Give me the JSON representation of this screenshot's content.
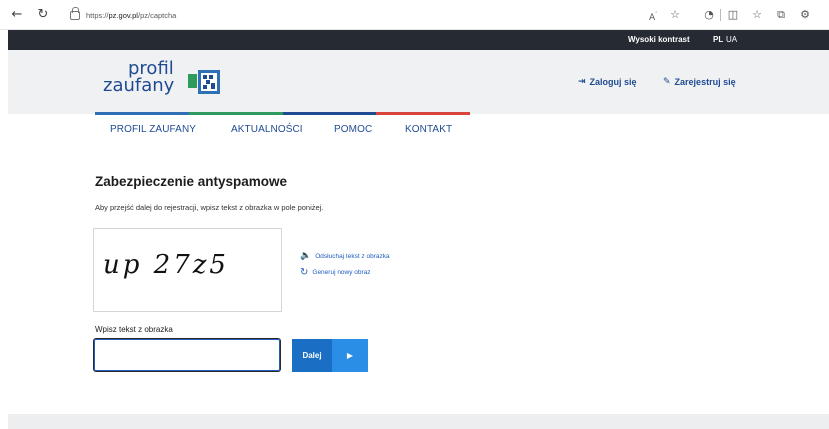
{
  "browser": {
    "url_prefix": "https://",
    "url_domain": "pz.gov.pl",
    "url_path": "/pz/captcha",
    "icons": [
      "back-icon",
      "refresh-icon",
      "lock-icon",
      "read-aloud-icon",
      "favorite-icon",
      "tracking-icon",
      "split-screen-icon",
      "favorites-list-icon",
      "collections-icon",
      "extensions-icon"
    ]
  },
  "topbar": {
    "high_contrast": "Wysoki kontrast",
    "lang_pl": "PL",
    "lang_ua": "UA"
  },
  "header": {
    "logo_line1": "profil",
    "logo_line2": "zaufany",
    "login": "Zaloguj się",
    "register": "Zarejestruj się",
    "accent_colors": [
      "#2f6fb5",
      "#2e9a5e",
      "#1f4b93",
      "#d9453b"
    ]
  },
  "nav": {
    "items": [
      "PROFIL ZAUFANY",
      "AKTUALNOŚCI",
      "POMOC",
      "KONTAKT"
    ]
  },
  "form": {
    "title": "Zabezpieczenie antyspamowe",
    "instruction": "Aby przejść dalej do rejestracji, wpisz tekst z obrazka w pole poniżej.",
    "captcha_text": "up 27z5",
    "listen_link": "Odsłuchaj tekst z obrazka",
    "regenerate_link": "Generuj nowy obraz",
    "input_label": "Wpisz tekst z obrazka",
    "input_value": "",
    "next_button": "Dalej"
  },
  "colors": {
    "brand_blue": "#1f4b93",
    "button_blue": "#1a6fc4",
    "topbar_dark": "#262b33"
  }
}
